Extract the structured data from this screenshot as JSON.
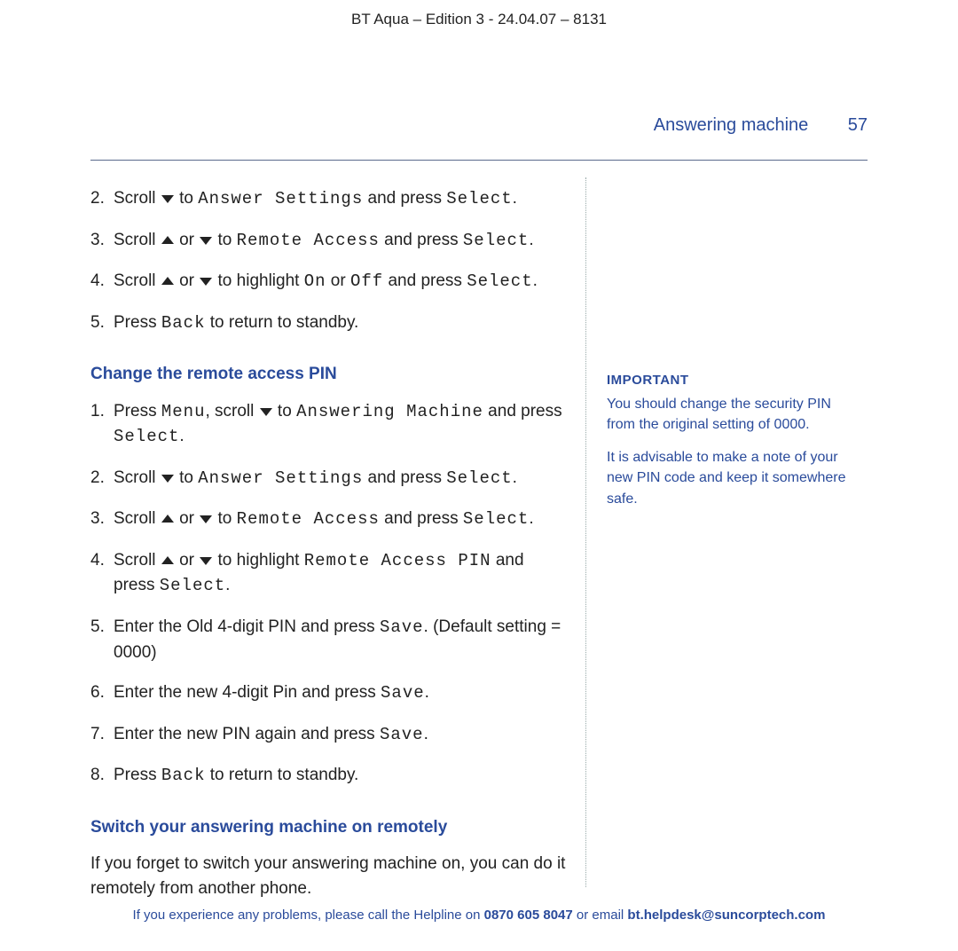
{
  "doc_header": "BT Aqua – Edition 3 -  24.04.07 – 8131",
  "section_title": "Answering machine",
  "page_number": "57",
  "list_a": {
    "items": [
      {
        "n": "2.",
        "parts": [
          "Scroll ",
          {
            "icon": "down"
          },
          " to ",
          {
            "lcd": "Answer Settings"
          },
          " and press ",
          {
            "lcd": "Select"
          },
          "."
        ]
      },
      {
        "n": "3.",
        "parts": [
          "Scroll ",
          {
            "icon": "up"
          },
          " or ",
          {
            "icon": "down"
          },
          " to ",
          {
            "lcd": "Remote Access"
          },
          " and press ",
          {
            "lcd": "Select"
          },
          "."
        ]
      },
      {
        "n": "4.",
        "parts": [
          "Scroll ",
          {
            "icon": "up"
          },
          " or ",
          {
            "icon": "down"
          },
          " to highlight ",
          {
            "lcd": "On"
          },
          " or ",
          {
            "lcd": "Off"
          },
          " and press ",
          {
            "lcd": "Select"
          },
          "."
        ]
      },
      {
        "n": "5.",
        "parts": [
          "Press ",
          {
            "lcd": "Back"
          },
          " to return to standby."
        ]
      }
    ]
  },
  "heading_b": "Change the remote access PIN",
  "list_b": {
    "items": [
      {
        "n": "1.",
        "parts": [
          "Press ",
          {
            "lcd": "Menu"
          },
          ", scroll ",
          {
            "icon": "down"
          },
          " to ",
          {
            "lcd": "Answering Machine"
          },
          " and press ",
          {
            "lcd": "Select"
          },
          "."
        ]
      },
      {
        "n": "2.",
        "parts": [
          "Scroll ",
          {
            "icon": "down"
          },
          " to ",
          {
            "lcd": "Answer Settings"
          },
          " and press ",
          {
            "lcd": "Select"
          },
          "."
        ]
      },
      {
        "n": "3.",
        "parts": [
          "Scroll ",
          {
            "icon": "up"
          },
          " or ",
          {
            "icon": "down"
          },
          " to ",
          {
            "lcd": "Remote Access"
          },
          " and press ",
          {
            "lcd": "Select"
          },
          "."
        ]
      },
      {
        "n": "4.",
        "parts": [
          "Scroll ",
          {
            "icon": "up"
          },
          " or ",
          {
            "icon": "down"
          },
          " to highlight ",
          {
            "lcd": "Remote Access PIN"
          },
          " and press ",
          {
            "lcd": "Select"
          },
          "."
        ]
      },
      {
        "n": "5.",
        "parts": [
          "Enter the Old 4-digit PIN and press ",
          {
            "lcd": "Save"
          },
          ". (Default setting = 0000)"
        ]
      },
      {
        "n": "6.",
        "parts": [
          "Enter the new 4-digit Pin and press ",
          {
            "lcd": "Save"
          },
          "."
        ]
      },
      {
        "n": "7.",
        "parts": [
          "Enter the new PIN again and press ",
          {
            "lcd": "Save"
          },
          "."
        ]
      },
      {
        "n": "8.",
        "parts": [
          "Press ",
          {
            "lcd": "Back"
          },
          " to return to standby."
        ]
      }
    ]
  },
  "heading_c": "Switch your answering machine on remotely",
  "intro_c": "If you forget to switch your answering machine on, you can do it remotely from another phone.",
  "side": {
    "important_label": "IMPORTANT",
    "p1": "You should change the security PIN from the original setting of 0000.",
    "p2": "It is advisable to make a note of your new PIN code and keep it somewhere safe."
  },
  "footer": {
    "pre": "If you experience any problems, please call the Helpline on ",
    "phone": "0870 605 8047",
    "mid": " or email ",
    "email": "bt.helpdesk@suncorptech.com"
  }
}
